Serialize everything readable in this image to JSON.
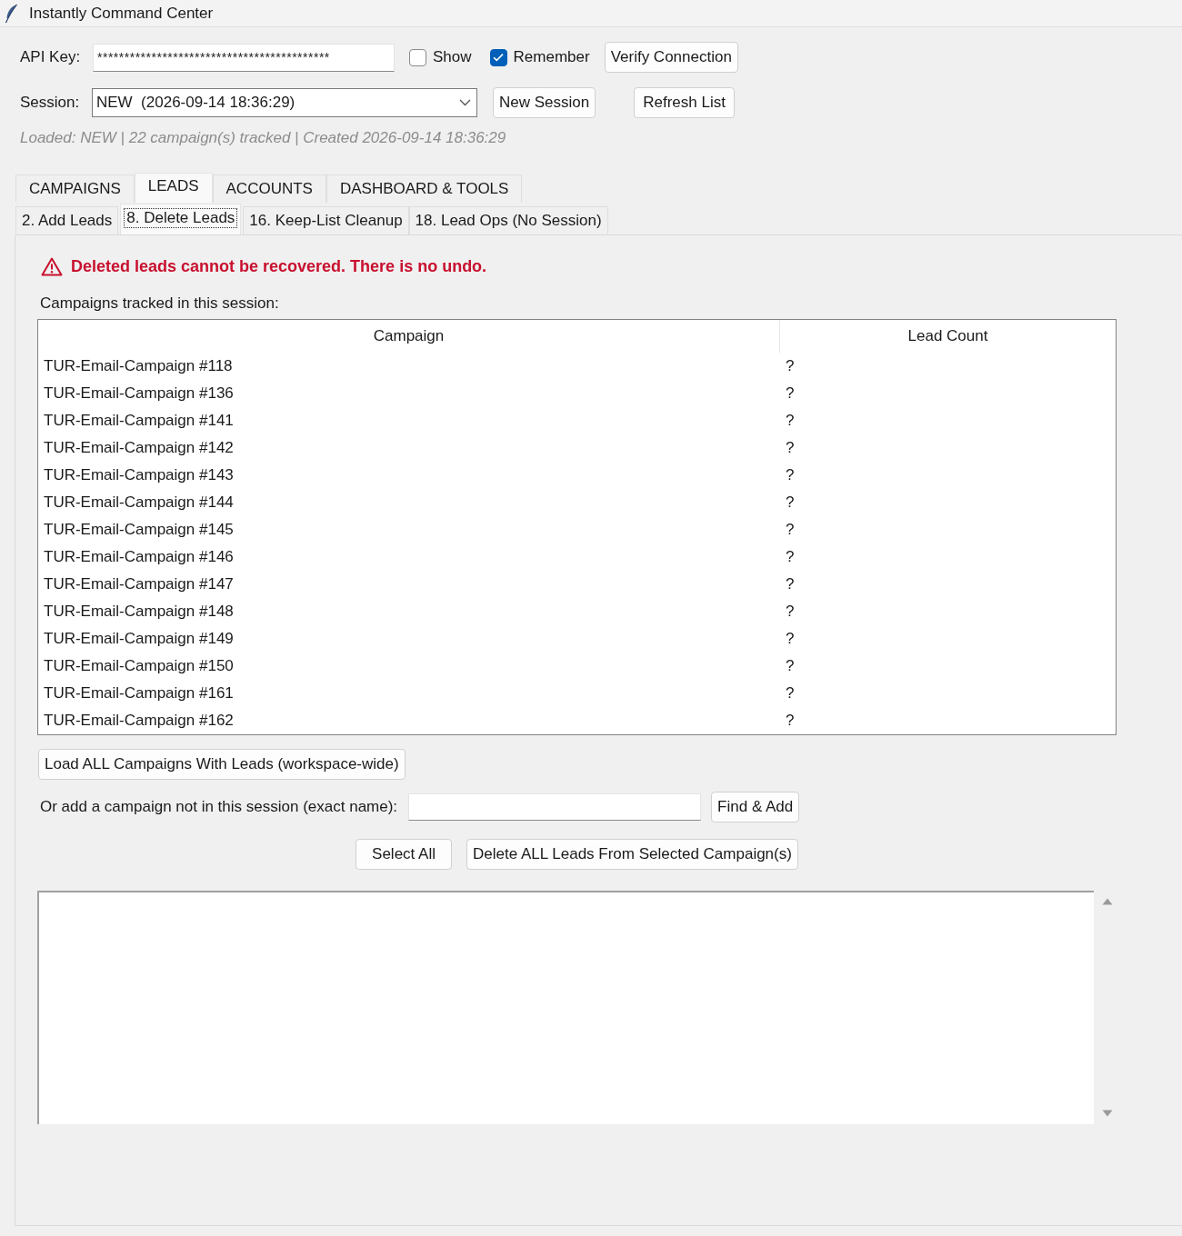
{
  "window": {
    "title": "Instantly Command Center"
  },
  "api_key": {
    "label": "API Key:",
    "value": "*******************************************",
    "show": {
      "label": "Show",
      "checked": false
    },
    "remember": {
      "label": "Remember",
      "checked": true
    },
    "verify_button": "Verify Connection"
  },
  "session": {
    "label": "Session:",
    "value": "NEW  (2026-09-14 18:36:29)",
    "new_button": "New Session",
    "refresh_button": "Refresh List",
    "status": "Loaded: NEW | 22 campaign(s) tracked | Created 2026-09-14 18:36:29"
  },
  "tabs": [
    {
      "label": "CAMPAIGNS",
      "selected": false
    },
    {
      "label": "LEADS",
      "selected": true
    },
    {
      "label": "ACCOUNTS",
      "selected": false
    },
    {
      "label": "DASHBOARD & TOOLS",
      "selected": false
    }
  ],
  "sub_tabs": [
    {
      "label": "2. Add Leads",
      "selected": false
    },
    {
      "label": "8. Delete Leads",
      "selected": true
    },
    {
      "label": "16. Keep-List Cleanup",
      "selected": false
    },
    {
      "label": "18. Lead Ops (No Session)",
      "selected": false
    }
  ],
  "warning": "Deleted leads cannot be recovered. There is no undo.",
  "table": {
    "caption": "Campaigns tracked in this session:",
    "columns": [
      "Campaign",
      "Lead Count"
    ],
    "rows": [
      {
        "campaign": "TUR-Email-Campaign #118",
        "lead_count": "?"
      },
      {
        "campaign": "TUR-Email-Campaign #136",
        "lead_count": "?"
      },
      {
        "campaign": "TUR-Email-Campaign #141",
        "lead_count": "?"
      },
      {
        "campaign": "TUR-Email-Campaign #142",
        "lead_count": "?"
      },
      {
        "campaign": "TUR-Email-Campaign #143",
        "lead_count": "?"
      },
      {
        "campaign": "TUR-Email-Campaign #144",
        "lead_count": "?"
      },
      {
        "campaign": "TUR-Email-Campaign #145",
        "lead_count": "?"
      },
      {
        "campaign": "TUR-Email-Campaign #146",
        "lead_count": "?"
      },
      {
        "campaign": "TUR-Email-Campaign #147",
        "lead_count": "?"
      },
      {
        "campaign": "TUR-Email-Campaign #148",
        "lead_count": "?"
      },
      {
        "campaign": "TUR-Email-Campaign #149",
        "lead_count": "?"
      },
      {
        "campaign": "TUR-Email-Campaign #150",
        "lead_count": "?"
      },
      {
        "campaign": "TUR-Email-Campaign #161",
        "lead_count": "?"
      },
      {
        "campaign": "TUR-Email-Campaign #162",
        "lead_count": "?"
      }
    ]
  },
  "load_all_button": "Load ALL Campaigns With Leads (workspace-wide)",
  "add_campaign": {
    "label": "Or add a campaign not in this session (exact name):",
    "button": "Find & Add"
  },
  "actions": [
    "Select All",
    "Delete ALL Leads From Selected Campaign(s)"
  ]
}
